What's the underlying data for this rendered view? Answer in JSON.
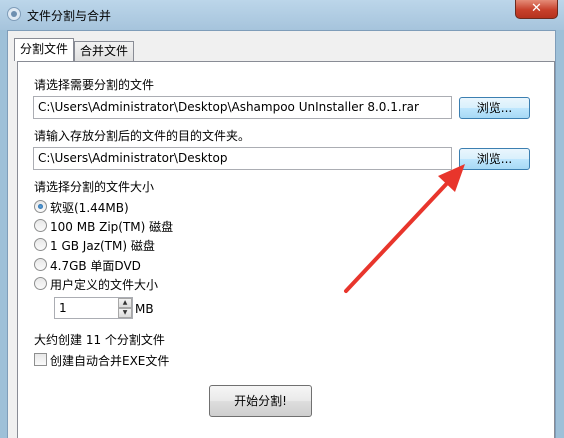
{
  "window": {
    "title": "文件分割与合并"
  },
  "tabs": [
    {
      "label": "分割文件"
    },
    {
      "label": "合并文件"
    }
  ],
  "split": {
    "select_file_label": "请选择需要分割的文件",
    "file_path": "C:\\Users\\Administrator\\Desktop\\Ashampoo UnInstaller 8.0.1.rar",
    "browse_label": "浏览...",
    "dest_label": "请输入存放分割后的文件的目的文件夹。",
    "dest_path": "C:\\Users\\Administrator\\Desktop",
    "size_label": "请选择分割的文件大小",
    "sizes": [
      {
        "label": "软驱(1.44MB)",
        "checked": true
      },
      {
        "label": "100 MB Zip(TM) 磁盘",
        "checked": false
      },
      {
        "label": "1 GB Jaz(TM) 磁盘",
        "checked": false
      },
      {
        "label": "4.7GB 单面DVD",
        "checked": false
      },
      {
        "label": "用户定义的文件大小",
        "checked": false
      }
    ],
    "custom_value": "1",
    "custom_unit": "MB",
    "estimate": "大约创建 11 个分割文件",
    "auto_merge_label": "创建自动合并EXE文件",
    "auto_merge_checked": false,
    "start_button": "开始分割!"
  },
  "colors": {
    "arrow": "#e8352c",
    "focus_border": "#3c7fb1"
  }
}
